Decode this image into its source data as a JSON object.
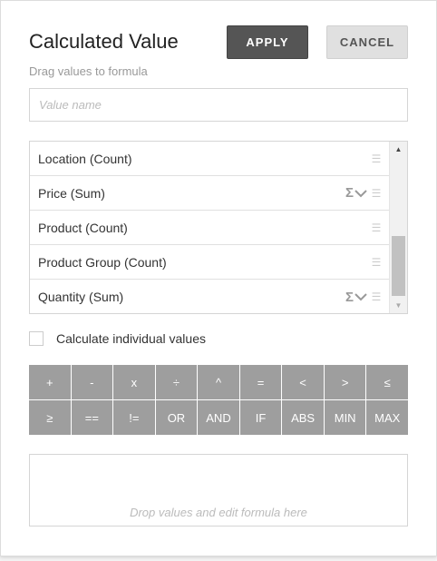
{
  "dialog": {
    "title": "Calculated Value",
    "subtitle": "Drag values to formula",
    "apply_label": "APPLY",
    "cancel_label": "CANCEL"
  },
  "name_input": {
    "placeholder": "Value name",
    "value": ""
  },
  "fields": [
    {
      "label": "Location (Count)",
      "has_aggregation": false
    },
    {
      "label": "Price (Sum)",
      "has_aggregation": true
    },
    {
      "label": "Product (Count)",
      "has_aggregation": false
    },
    {
      "label": "Product Group (Count)",
      "has_aggregation": false
    },
    {
      "label": "Quantity (Sum)",
      "has_aggregation": true
    }
  ],
  "icons": {
    "aggregation": "sigma-icon",
    "dropdown": "chevron-down-icon",
    "drag": "drag-handle-icon",
    "scroll_up": "scroll-up-arrow",
    "scroll_down": "scroll-down-arrow"
  },
  "scroll_position": 0.65,
  "checkbox": {
    "label": "Calculate individual values",
    "checked": false
  },
  "operators": [
    "+",
    "-",
    "x",
    "÷",
    "^",
    "=",
    "<",
    ">",
    "≤",
    "≥",
    "==",
    "!=",
    "OR",
    "AND",
    "IF",
    "ABS",
    "MIN",
    "MAX"
  ],
  "formula": {
    "placeholder": "Drop values and edit formula here"
  },
  "colors": {
    "apply_bg": "#555555",
    "cancel_bg": "#e0e0e0",
    "operator_bg": "#9e9e9e"
  }
}
